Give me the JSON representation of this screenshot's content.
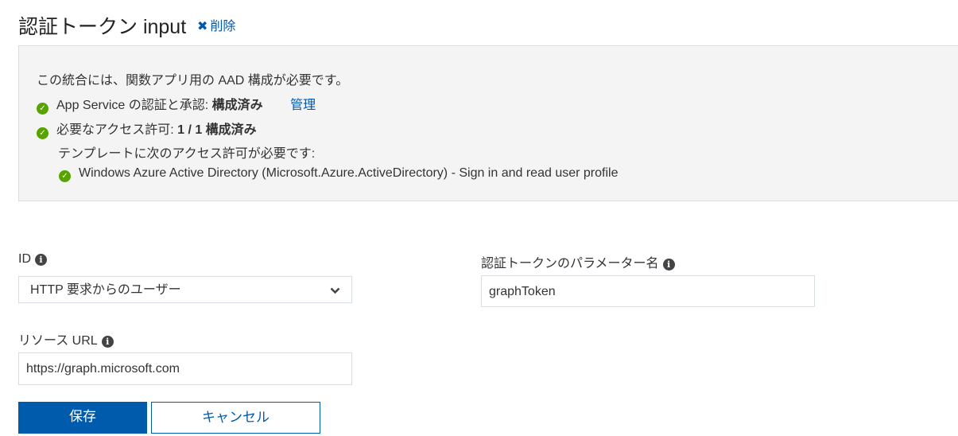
{
  "header": {
    "title": "認証トークン input",
    "delete_icon": "close-icon",
    "delete_label": "削除"
  },
  "panel": {
    "intro": "この統合には、関数アプリ用の AAD 構成が必要です。",
    "auth_prefix": "App Service の認証と承認: ",
    "auth_status": "構成済み",
    "manage_link": "管理",
    "perm_prefix": "必要なアクセス許可: ",
    "perm_status": "1 / 1 構成済み",
    "template_note": "テンプレートに次のアクセス許可が必要です:",
    "permission_item": "Windows Azure Active Directory (Microsoft.Azure.ActiveDirectory) - Sign in and read user profile",
    "status_color": "#57a300"
  },
  "form": {
    "id_label": "ID",
    "id_value": "HTTP 要求からのユーザー",
    "resource_label": "リソース URL",
    "resource_value": "https://graph.microsoft.com",
    "param_label": "認証トークンのパラメーター名",
    "param_value": "graphToken"
  },
  "buttons": {
    "save": "保存",
    "cancel": "キャンセル",
    "accent": "#005bac"
  }
}
